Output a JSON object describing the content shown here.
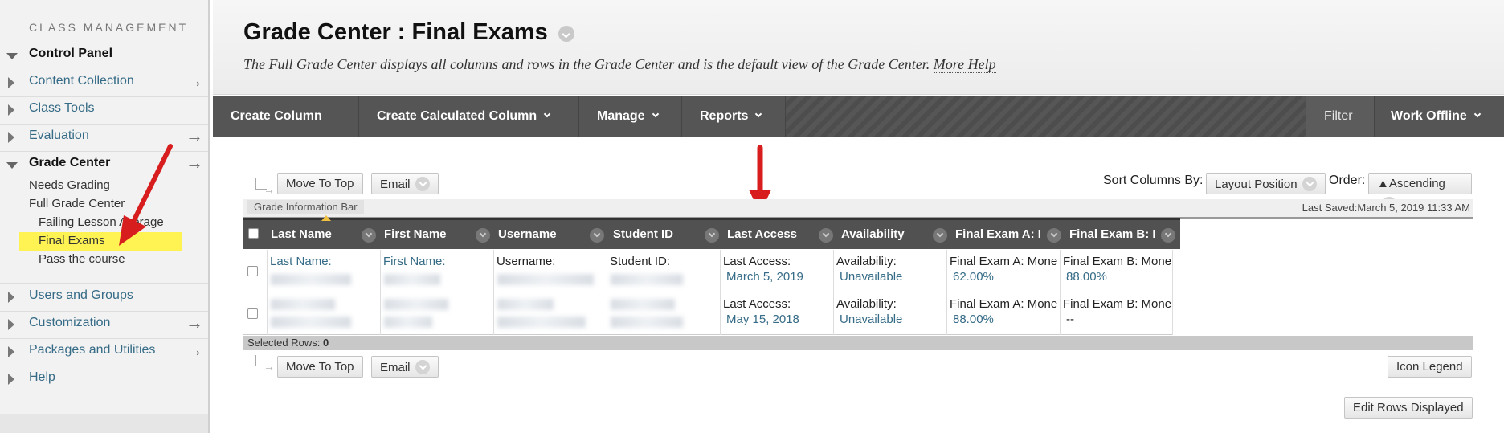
{
  "sidebar": {
    "heading": "CLASS MANAGEMENT",
    "control_panel": "Control Panel",
    "items": [
      {
        "label": "Content Collection"
      },
      {
        "label": "Class Tools"
      },
      {
        "label": "Evaluation"
      }
    ],
    "grade_center": {
      "label": "Grade Center",
      "subitems": [
        "Needs Grading",
        "Full Grade Center",
        "Failing Lesson Average",
        "Final Exams",
        "Pass the course"
      ]
    },
    "items_bottom": [
      {
        "label": "Users and Groups"
      },
      {
        "label": "Customization"
      },
      {
        "label": "Packages and Utilities"
      },
      {
        "label": "Help"
      }
    ],
    "expand_arrow": "→"
  },
  "header": {
    "title": "Grade Center : Final Exams",
    "description": "The Full Grade Center displays all columns and rows in the Grade Center and is the default view of the Grade Center.",
    "more_help": "More Help"
  },
  "actionbar": {
    "create_column": "Create Column",
    "create_calculated_column": "Create Calculated Column",
    "manage": "Manage",
    "reports": "Reports",
    "filter": "Filter",
    "work_offline": "Work Offline"
  },
  "grid": {
    "move_to_top": "Move To Top",
    "email": "Email",
    "sort_columns_by_label": "Sort Columns By:",
    "sort_columns_by_value": "Layout Position",
    "order_label": "Order:",
    "order_value": "▲Ascending",
    "info_bar": "Grade Information Bar",
    "last_saved": "Last Saved:March 5, 2019 11:33 AM",
    "columns": [
      "Last Name",
      "First Name",
      "Username",
      "Student ID",
      "Last Access",
      "Availability",
      "Final Exam A: I",
      "Final Exam B: I"
    ],
    "rows": [
      {
        "last_name": "Last Name:",
        "first_name": "First Name:",
        "username": "Username:",
        "student_id": "Student ID:",
        "last_access_label": "Last Access:",
        "last_access": "March 5, 2019",
        "availability_label": "Availability:",
        "availability": "Unavailable",
        "exam_a_label": "Final Exam A: Mone",
        "exam_a": "62.00%",
        "exam_b_label": "Final Exam B: Mone",
        "exam_b": "88.00%"
      },
      {
        "last_access_label": "Last Access:",
        "last_access": "May 15, 2018",
        "availability_label": "Availability:",
        "availability": "Unavailable",
        "exam_a_label": "Final Exam A: Mone",
        "exam_a": "88.00%",
        "exam_b_label": "Final Exam B: Mone",
        "exam_b": "--"
      }
    ],
    "selected_rows_label": "Selected Rows:",
    "selected_rows_count": "0",
    "icon_legend": "Icon Legend",
    "edit_rows_displayed": "Edit Rows Displayed"
  },
  "colors": {
    "link": "#356b86",
    "highlight": "#fff354",
    "annotation_arrow": "#d71d1d",
    "actionbar": "#555555"
  }
}
